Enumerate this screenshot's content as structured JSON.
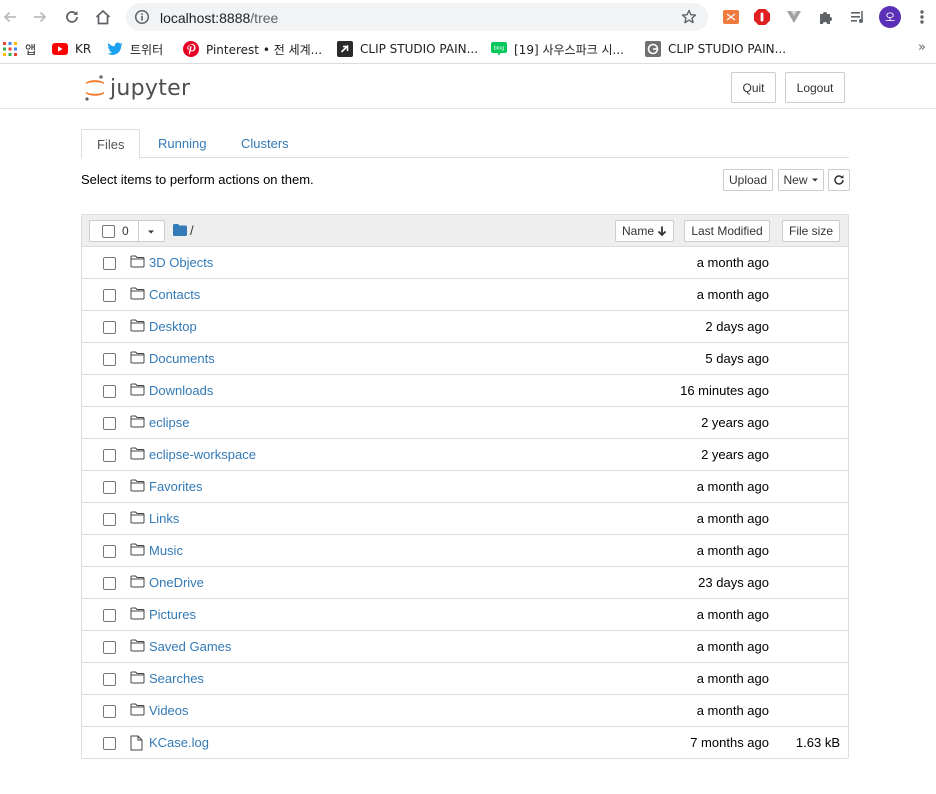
{
  "browser": {
    "url_host": "localhost:8888",
    "url_path": "/tree",
    "avatar_letter": "오",
    "icons": [
      "back-arrow-icon",
      "forward-arrow-icon",
      "reload-icon",
      "home-icon",
      "info-icon",
      "star-icon",
      "extension-icons",
      "puzzle-icon",
      "media-icon",
      "menu-dots-icon"
    ]
  },
  "bookmarks": {
    "items": [
      {
        "label": "앱",
        "icon": "apps-grid-icon"
      },
      {
        "label": "KR",
        "icon": "youtube-icon"
      },
      {
        "label": "트위터",
        "icon": "twitter-icon"
      },
      {
        "label": "Pinterest • 전 세계...",
        "icon": "pinterest-icon"
      },
      {
        "label": "CLIP STUDIO PAIN...",
        "icon": "clip-studio-icon"
      },
      {
        "label": "[19] 사우스파크 시...",
        "icon": "blog-icon"
      },
      {
        "label": "CLIP STUDIO PAIN...",
        "icon": "clip-studio-icon"
      }
    ],
    "more": "»"
  },
  "header": {
    "logo_text": "jupyter",
    "quit_label": "Quit",
    "logout_label": "Logout"
  },
  "tabs": [
    {
      "label": "Files",
      "active": true
    },
    {
      "label": "Running",
      "active": false
    },
    {
      "label": "Clusters",
      "active": false
    }
  ],
  "toolbar": {
    "hint": "Select items to perform actions on them.",
    "upload_label": "Upload",
    "new_label": "New",
    "refresh_icon": "refresh-icon"
  },
  "list_header": {
    "selected_count": "0",
    "path": "/",
    "name_label": "Name",
    "modified_label": "Last Modified",
    "size_label": "File size"
  },
  "files": [
    {
      "name": "3D Objects",
      "type": "folder",
      "modified": "a month ago",
      "size": ""
    },
    {
      "name": "Contacts",
      "type": "folder",
      "modified": "a month ago",
      "size": ""
    },
    {
      "name": "Desktop",
      "type": "folder",
      "modified": "2 days ago",
      "size": ""
    },
    {
      "name": "Documents",
      "type": "folder",
      "modified": "5 days ago",
      "size": ""
    },
    {
      "name": "Downloads",
      "type": "folder",
      "modified": "16 minutes ago",
      "size": ""
    },
    {
      "name": "eclipse",
      "type": "folder",
      "modified": "2 years ago",
      "size": ""
    },
    {
      "name": "eclipse-workspace",
      "type": "folder",
      "modified": "2 years ago",
      "size": ""
    },
    {
      "name": "Favorites",
      "type": "folder",
      "modified": "a month ago",
      "size": ""
    },
    {
      "name": "Links",
      "type": "folder",
      "modified": "a month ago",
      "size": ""
    },
    {
      "name": "Music",
      "type": "folder",
      "modified": "a month ago",
      "size": ""
    },
    {
      "name": "OneDrive",
      "type": "folder",
      "modified": "23 days ago",
      "size": ""
    },
    {
      "name": "Pictures",
      "type": "folder",
      "modified": "a month ago",
      "size": ""
    },
    {
      "name": "Saved Games",
      "type": "folder",
      "modified": "a month ago",
      "size": ""
    },
    {
      "name": "Searches",
      "type": "folder",
      "modified": "a month ago",
      "size": ""
    },
    {
      "name": "Videos",
      "type": "folder",
      "modified": "a month ago",
      "size": ""
    },
    {
      "name": "KCase.log",
      "type": "file",
      "modified": "7 months ago",
      "size": "1.63 kB"
    }
  ]
}
